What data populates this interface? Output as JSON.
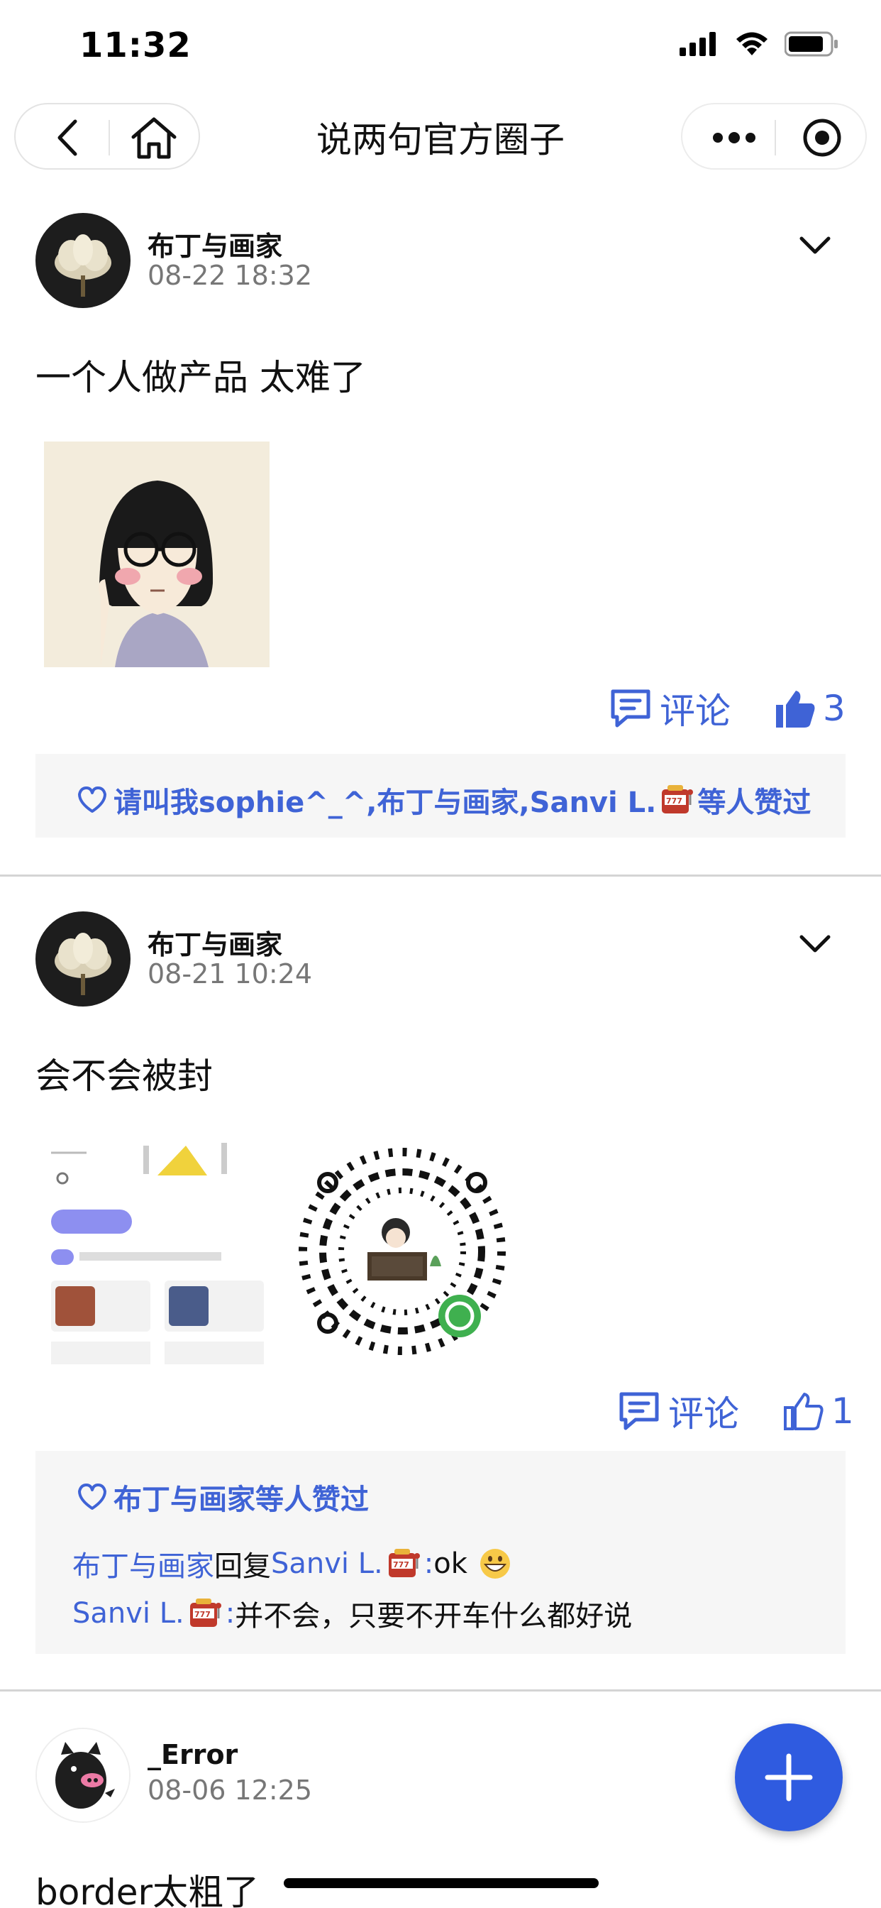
{
  "status_bar": {
    "time": "11:32"
  },
  "nav": {
    "title": "说两句官方圈子"
  },
  "posts": [
    {
      "author": "布丁与画家",
      "time": "08-22 18:32",
      "text": "一个人做产品 太难了",
      "comment_label": "评论",
      "like_count": "3",
      "likes_text": "请叫我sophie^_^,布丁与画家,Sanvi L. ",
      "likes_suffix": "等人赞过"
    },
    {
      "author": "布丁与画家",
      "time": "08-21 10:24",
      "text": "会不会被封",
      "comment_label": "评论",
      "like_count": "1",
      "likes_text": "布丁与画家等人赞过",
      "replies": [
        {
          "from": "布丁与画家",
          "verb": "回复",
          "to": "Sanvi L. ",
          "sep": ":",
          "body": "ok"
        },
        {
          "from": "Sanvi L. ",
          "sep": ":",
          "body": "并不会，只要不开车什么都好说"
        }
      ]
    },
    {
      "author": "_Error",
      "time": "08-06 12:25",
      "text": "border太粗了"
    }
  ],
  "colors": {
    "accent": "#3f63d6",
    "fab": "#2f5be0",
    "like_bg": "#f6f6f6"
  }
}
